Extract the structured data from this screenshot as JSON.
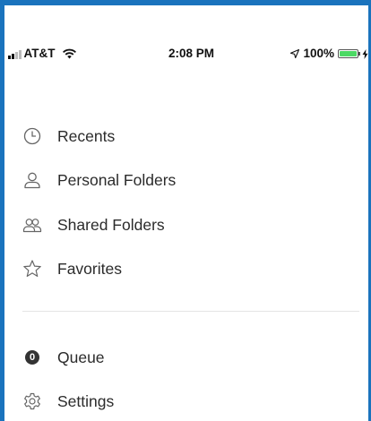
{
  "status_bar": {
    "carrier": "AT&T",
    "time": "2:08 PM",
    "battery": "100%",
    "battery_level": 1.0,
    "battery_color": "#4cd964"
  },
  "menu": {
    "items": [
      {
        "label": "Recents",
        "icon": "clock-icon"
      },
      {
        "label": "Personal Folders",
        "icon": "person-icon"
      },
      {
        "label": "Shared Folders",
        "icon": "people-icon"
      },
      {
        "label": "Favorites",
        "icon": "star-icon"
      }
    ],
    "secondary": [
      {
        "label": "Queue",
        "icon": "queue-badge",
        "badge": "0"
      },
      {
        "label": "Settings",
        "icon": "gear-icon"
      }
    ]
  },
  "colors": {
    "frame": "#1a73bd",
    "background": "#ffffff",
    "text": "#2b2b2b",
    "icon": "#666666"
  }
}
